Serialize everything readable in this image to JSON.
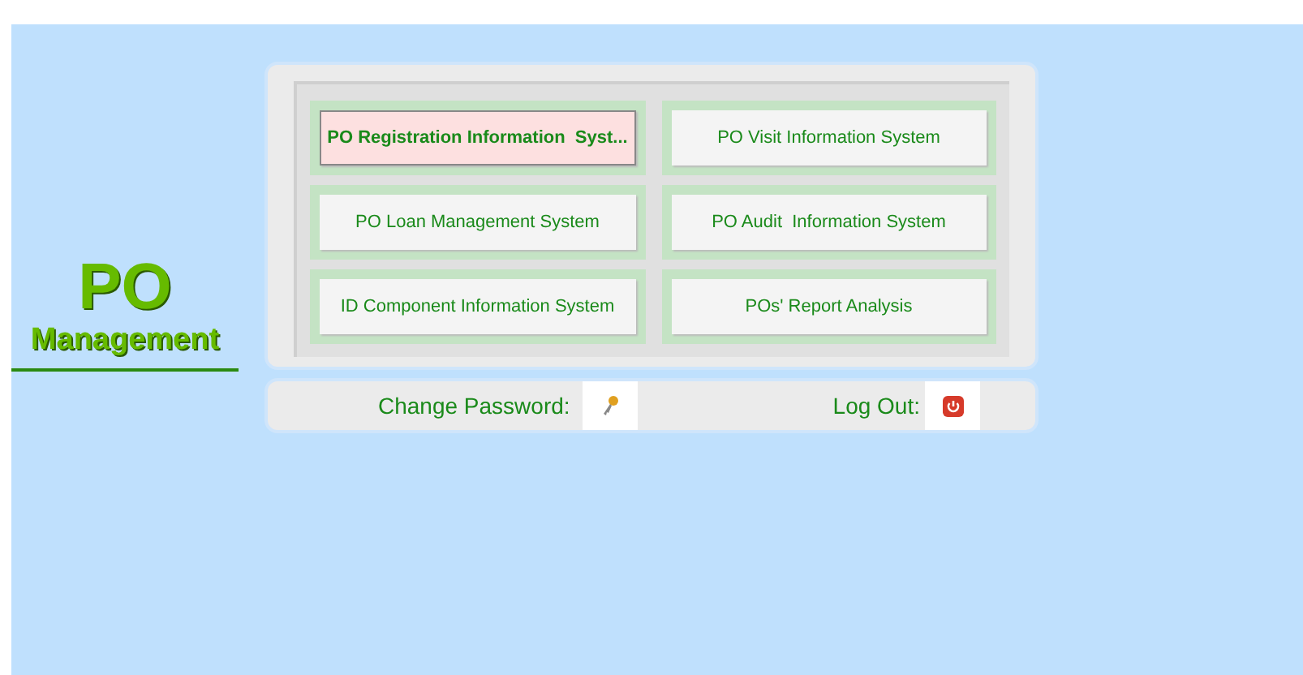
{
  "brand": {
    "title": "PO",
    "subtitle": "Management"
  },
  "systems": [
    {
      "label": "PO Registration Information  Syst...",
      "selected": true
    },
    {
      "label": "PO Visit Information System",
      "selected": false
    },
    {
      "label": "PO Loan Management System",
      "selected": false
    },
    {
      "label": "PO Audit  Information System",
      "selected": false
    },
    {
      "label": "ID Component Information System",
      "selected": false
    },
    {
      "label": "POs' Report Analysis",
      "selected": false
    }
  ],
  "footer": {
    "change_password": "Change Password:",
    "log_out": "Log Out:"
  }
}
